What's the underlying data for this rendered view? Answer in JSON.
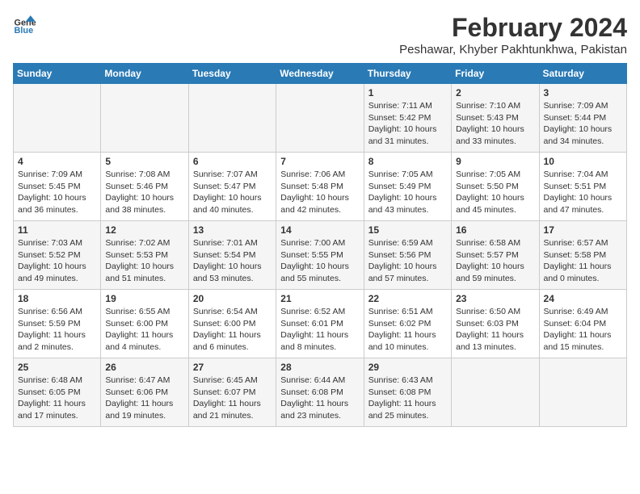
{
  "header": {
    "logo_general": "General",
    "logo_blue": "Blue",
    "month_year": "February 2024",
    "location": "Peshawar, Khyber Pakhtunkhwa, Pakistan"
  },
  "weekdays": [
    "Sunday",
    "Monday",
    "Tuesday",
    "Wednesday",
    "Thursday",
    "Friday",
    "Saturday"
  ],
  "weeks": [
    [
      {
        "day": "",
        "sunrise": "",
        "sunset": "",
        "daylight": ""
      },
      {
        "day": "",
        "sunrise": "",
        "sunset": "",
        "daylight": ""
      },
      {
        "day": "",
        "sunrise": "",
        "sunset": "",
        "daylight": ""
      },
      {
        "day": "",
        "sunrise": "",
        "sunset": "",
        "daylight": ""
      },
      {
        "day": "1",
        "sunrise": "Sunrise: 7:11 AM",
        "sunset": "Sunset: 5:42 PM",
        "daylight": "Daylight: 10 hours and 31 minutes."
      },
      {
        "day": "2",
        "sunrise": "Sunrise: 7:10 AM",
        "sunset": "Sunset: 5:43 PM",
        "daylight": "Daylight: 10 hours and 33 minutes."
      },
      {
        "day": "3",
        "sunrise": "Sunrise: 7:09 AM",
        "sunset": "Sunset: 5:44 PM",
        "daylight": "Daylight: 10 hours and 34 minutes."
      }
    ],
    [
      {
        "day": "4",
        "sunrise": "Sunrise: 7:09 AM",
        "sunset": "Sunset: 5:45 PM",
        "daylight": "Daylight: 10 hours and 36 minutes."
      },
      {
        "day": "5",
        "sunrise": "Sunrise: 7:08 AM",
        "sunset": "Sunset: 5:46 PM",
        "daylight": "Daylight: 10 hours and 38 minutes."
      },
      {
        "day": "6",
        "sunrise": "Sunrise: 7:07 AM",
        "sunset": "Sunset: 5:47 PM",
        "daylight": "Daylight: 10 hours and 40 minutes."
      },
      {
        "day": "7",
        "sunrise": "Sunrise: 7:06 AM",
        "sunset": "Sunset: 5:48 PM",
        "daylight": "Daylight: 10 hours and 42 minutes."
      },
      {
        "day": "8",
        "sunrise": "Sunrise: 7:05 AM",
        "sunset": "Sunset: 5:49 PM",
        "daylight": "Daylight: 10 hours and 43 minutes."
      },
      {
        "day": "9",
        "sunrise": "Sunrise: 7:05 AM",
        "sunset": "Sunset: 5:50 PM",
        "daylight": "Daylight: 10 hours and 45 minutes."
      },
      {
        "day": "10",
        "sunrise": "Sunrise: 7:04 AM",
        "sunset": "Sunset: 5:51 PM",
        "daylight": "Daylight: 10 hours and 47 minutes."
      }
    ],
    [
      {
        "day": "11",
        "sunrise": "Sunrise: 7:03 AM",
        "sunset": "Sunset: 5:52 PM",
        "daylight": "Daylight: 10 hours and 49 minutes."
      },
      {
        "day": "12",
        "sunrise": "Sunrise: 7:02 AM",
        "sunset": "Sunset: 5:53 PM",
        "daylight": "Daylight: 10 hours and 51 minutes."
      },
      {
        "day": "13",
        "sunrise": "Sunrise: 7:01 AM",
        "sunset": "Sunset: 5:54 PM",
        "daylight": "Daylight: 10 hours and 53 minutes."
      },
      {
        "day": "14",
        "sunrise": "Sunrise: 7:00 AM",
        "sunset": "Sunset: 5:55 PM",
        "daylight": "Daylight: 10 hours and 55 minutes."
      },
      {
        "day": "15",
        "sunrise": "Sunrise: 6:59 AM",
        "sunset": "Sunset: 5:56 PM",
        "daylight": "Daylight: 10 hours and 57 minutes."
      },
      {
        "day": "16",
        "sunrise": "Sunrise: 6:58 AM",
        "sunset": "Sunset: 5:57 PM",
        "daylight": "Daylight: 10 hours and 59 minutes."
      },
      {
        "day": "17",
        "sunrise": "Sunrise: 6:57 AM",
        "sunset": "Sunset: 5:58 PM",
        "daylight": "Daylight: 11 hours and 0 minutes."
      }
    ],
    [
      {
        "day": "18",
        "sunrise": "Sunrise: 6:56 AM",
        "sunset": "Sunset: 5:59 PM",
        "daylight": "Daylight: 11 hours and 2 minutes."
      },
      {
        "day": "19",
        "sunrise": "Sunrise: 6:55 AM",
        "sunset": "Sunset: 6:00 PM",
        "daylight": "Daylight: 11 hours and 4 minutes."
      },
      {
        "day": "20",
        "sunrise": "Sunrise: 6:54 AM",
        "sunset": "Sunset: 6:00 PM",
        "daylight": "Daylight: 11 hours and 6 minutes."
      },
      {
        "day": "21",
        "sunrise": "Sunrise: 6:52 AM",
        "sunset": "Sunset: 6:01 PM",
        "daylight": "Daylight: 11 hours and 8 minutes."
      },
      {
        "day": "22",
        "sunrise": "Sunrise: 6:51 AM",
        "sunset": "Sunset: 6:02 PM",
        "daylight": "Daylight: 11 hours and 10 minutes."
      },
      {
        "day": "23",
        "sunrise": "Sunrise: 6:50 AM",
        "sunset": "Sunset: 6:03 PM",
        "daylight": "Daylight: 11 hours and 13 minutes."
      },
      {
        "day": "24",
        "sunrise": "Sunrise: 6:49 AM",
        "sunset": "Sunset: 6:04 PM",
        "daylight": "Daylight: 11 hours and 15 minutes."
      }
    ],
    [
      {
        "day": "25",
        "sunrise": "Sunrise: 6:48 AM",
        "sunset": "Sunset: 6:05 PM",
        "daylight": "Daylight: 11 hours and 17 minutes."
      },
      {
        "day": "26",
        "sunrise": "Sunrise: 6:47 AM",
        "sunset": "Sunset: 6:06 PM",
        "daylight": "Daylight: 11 hours and 19 minutes."
      },
      {
        "day": "27",
        "sunrise": "Sunrise: 6:45 AM",
        "sunset": "Sunset: 6:07 PM",
        "daylight": "Daylight: 11 hours and 21 minutes."
      },
      {
        "day": "28",
        "sunrise": "Sunrise: 6:44 AM",
        "sunset": "Sunset: 6:08 PM",
        "daylight": "Daylight: 11 hours and 23 minutes."
      },
      {
        "day": "29",
        "sunrise": "Sunrise: 6:43 AM",
        "sunset": "Sunset: 6:08 PM",
        "daylight": "Daylight: 11 hours and 25 minutes."
      },
      {
        "day": "",
        "sunrise": "",
        "sunset": "",
        "daylight": ""
      },
      {
        "day": "",
        "sunrise": "",
        "sunset": "",
        "daylight": ""
      }
    ]
  ]
}
